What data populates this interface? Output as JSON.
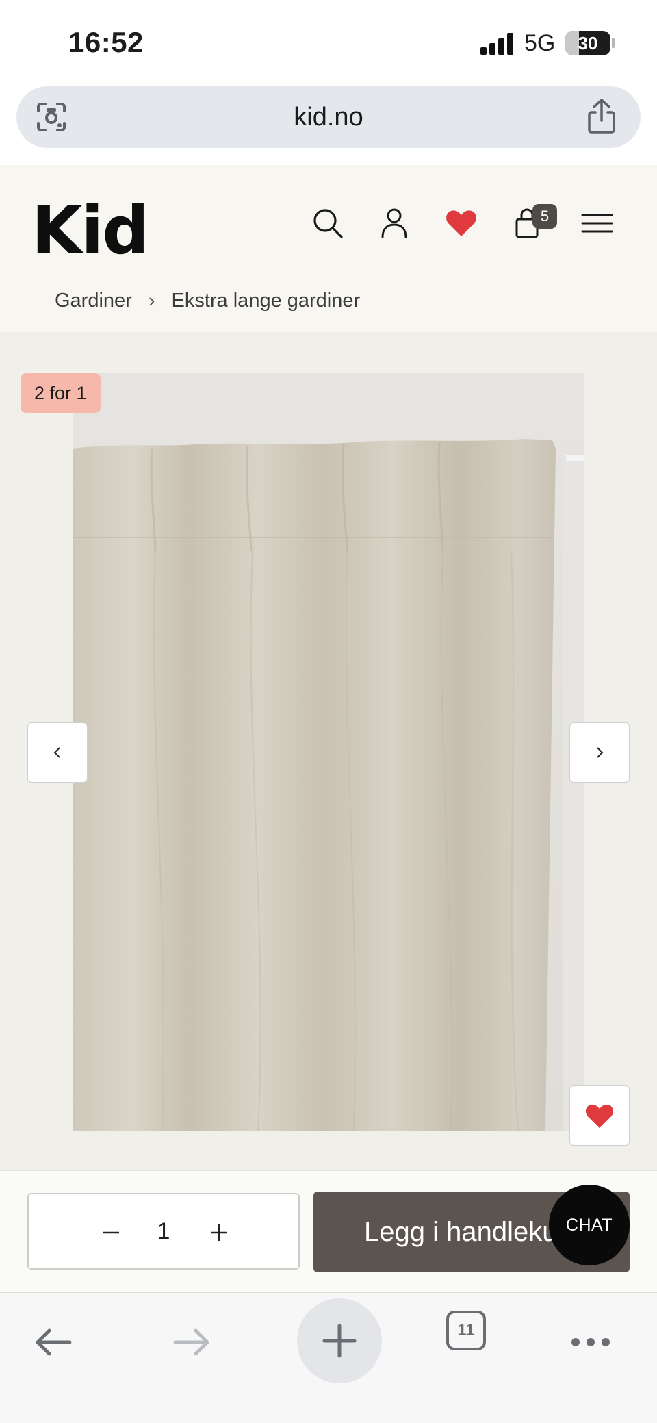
{
  "status_bar": {
    "time": "16:52",
    "network": "5G",
    "battery": "30",
    "battery_level": 0.3
  },
  "browser": {
    "url": "kid.no",
    "tab_count": "11"
  },
  "header": {
    "logo": "Kid",
    "cart_count": "5",
    "icons": [
      "search-icon",
      "account-icon",
      "heart-icon",
      "bag-icon",
      "menu-icon"
    ],
    "wishlist_color": "#e0393e"
  },
  "breadcrumb": {
    "items": [
      "Gardiner",
      "Ekstra lange gardiner"
    ]
  },
  "product": {
    "badge": "2 for 1",
    "image_alt_icon": "curtain-product-photo",
    "badge_color": "#f7b8ac"
  },
  "purchase": {
    "quantity": "1",
    "add_to_cart": "Legg i handlekurv",
    "chat": "CHAT",
    "button_color": "#5c554f"
  }
}
